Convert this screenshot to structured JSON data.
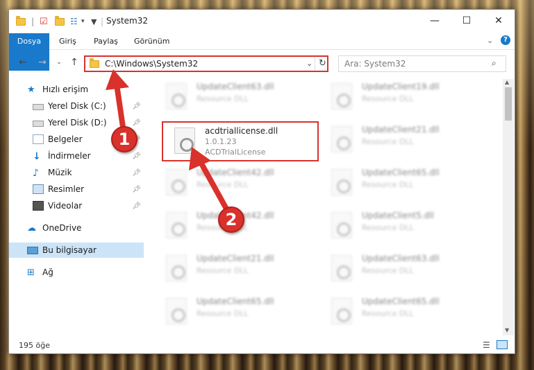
{
  "window": {
    "title": "System32"
  },
  "ribbon": {
    "tabs": [
      {
        "label": "Dosya"
      },
      {
        "label": "Giriş"
      },
      {
        "label": "Paylaş"
      },
      {
        "label": "Görünüm"
      }
    ]
  },
  "nav": {
    "address": "C:\\Windows\\System32",
    "search_placeholder": "Ara: System32"
  },
  "sidebar": {
    "items": [
      {
        "label": "Hızlı erişim",
        "icon": "star-icon"
      },
      {
        "label": "Yerel Disk (C:)",
        "icon": "drive-icon"
      },
      {
        "label": "Yerel Disk (D:)",
        "icon": "drive-icon"
      },
      {
        "label": "Belgeler",
        "icon": "documents-icon"
      },
      {
        "label": "İndirmeler",
        "icon": "download-icon"
      },
      {
        "label": "Müzik",
        "icon": "music-icon"
      },
      {
        "label": "Resimler",
        "icon": "pictures-icon"
      },
      {
        "label": "Videolar",
        "icon": "videos-icon"
      },
      {
        "label": "OneDrive",
        "icon": "cloud-icon"
      },
      {
        "label": "Bu bilgisayar",
        "icon": "computer-icon"
      },
      {
        "label": "Ağ",
        "icon": "network-icon"
      }
    ]
  },
  "files": {
    "focus": {
      "name": "acdtriallicense.dll",
      "version": "1.0.1.23",
      "description": "ACDTrialLicense"
    },
    "left": [
      {
        "name": "UpdateClient63.dll",
        "sub": "Resource DLL"
      },
      {
        "name": "UpdateClient42.dll",
        "sub": "Resource DLL"
      },
      {
        "name": "UpdateClient42.dll",
        "sub": "Resource DLL"
      },
      {
        "name": "UpdateClient21.dll",
        "sub": "Resource DLL"
      },
      {
        "name": "UpdateClient65.dll",
        "sub": "Resource DLL"
      }
    ],
    "right": [
      {
        "name": "UpdateClient19.dll",
        "sub": "Resource DLL"
      },
      {
        "name": "UpdateClient21.dll",
        "sub": "Resource DLL"
      },
      {
        "name": "UpdateClient65.dll",
        "sub": "Resource DLL"
      },
      {
        "name": "UpdateClient5.dll",
        "sub": "Resource DLL"
      },
      {
        "name": "UpdateClient63.dll",
        "sub": "Resource DLL"
      },
      {
        "name": "UpdateClient65.dll",
        "sub": "Resource DLL"
      }
    ]
  },
  "status": {
    "count": "195 öğe"
  },
  "callouts": {
    "one": "1",
    "two": "2"
  },
  "colors": {
    "accent": "#1979ca",
    "highlight": "#d9312b"
  }
}
